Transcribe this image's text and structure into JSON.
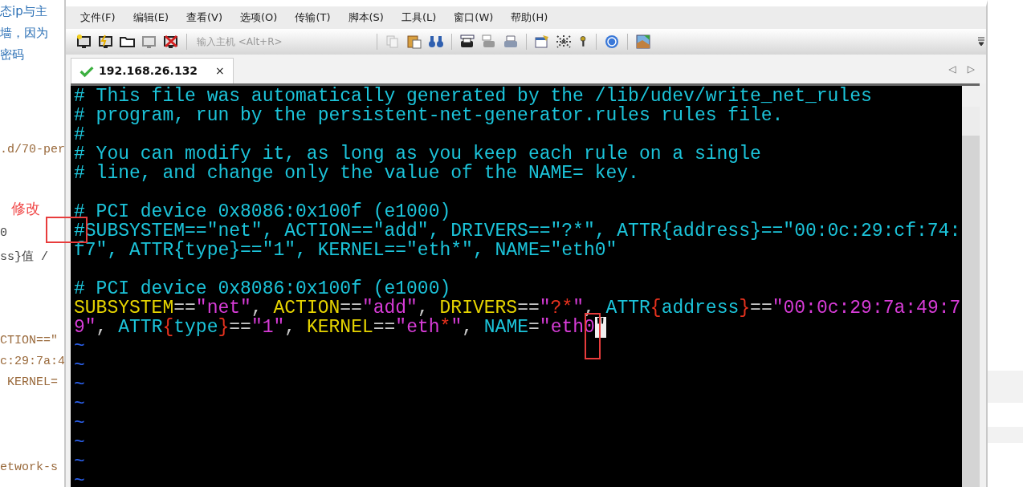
{
  "background_doc": {
    "lines": [
      {
        "text": "态ip与主",
        "kind": "link"
      },
      {
        "text": "墙，因为",
        "kind": "link"
      },
      {
        "text": "密码",
        "kind": "link"
      },
      {
        "text": ".d/70-per",
        "kind": "code"
      },
      {
        "text": "0",
        "kind": "plain"
      },
      {
        "text": "ss}值 /",
        "kind": "plain"
      },
      {
        "text": "CTION==\"",
        "kind": "code"
      },
      {
        "text": "c:29:7a:4",
        "kind": "code"
      },
      {
        "text": " KERNEL=",
        "kind": "code"
      },
      {
        "text": "etwork-s",
        "kind": "code"
      }
    ]
  },
  "menu": [
    "文件(F)",
    "编辑(E)",
    "查看(V)",
    "选项(O)",
    "传输(T)",
    "脚本(S)",
    "工具(L)",
    "窗口(W)",
    "帮助(H)"
  ],
  "toolbar": {
    "host_field": {
      "placeholder": "输入主机 <Alt+R>"
    }
  },
  "tabs": [
    {
      "label": "192.168.26.132",
      "selected": true,
      "connected": true,
      "close": "×"
    }
  ],
  "tab_arrows": [
    "◁",
    "▷"
  ],
  "terminal": {
    "lines": [
      {
        "kind": "text",
        "segments": [
          {
            "text": "# This file was automatically generated by the /lib/udev/write_net_rules",
            "color": "#1cc4da"
          }
        ]
      },
      {
        "kind": "text",
        "segments": [
          {
            "text": "# program, run by the persistent-net-generator.rules rules file.",
            "color": "#1cc4da"
          }
        ]
      },
      {
        "kind": "text",
        "segments": [
          {
            "text": "#",
            "color": "#1cc4da"
          }
        ]
      },
      {
        "kind": "text",
        "segments": [
          {
            "text": "# You can modify it, as long as you keep each rule on a single",
            "color": "#1cc4da"
          }
        ]
      },
      {
        "kind": "text",
        "segments": [
          {
            "text": "# line, and change only the value of the NAME= key.",
            "color": "#1cc4da"
          }
        ]
      },
      {
        "kind": "blank"
      },
      {
        "kind": "text",
        "segments": [
          {
            "text": "# PCI device 0x8086:0x100f (e1000)",
            "color": "#1cc4da"
          }
        ]
      },
      {
        "kind": "text",
        "segments": [
          {
            "text": "#SUBSYSTEM==\"net\", ACTION==\"add\", DRIVERS==\"?*\", ATTR{address}==\"00:0c:29:cf:74:",
            "color": "#1cc4da"
          }
        ]
      },
      {
        "kind": "text",
        "segments": [
          {
            "text": "f7\", ATTR{type}==\"1\", KERNEL==\"eth*\", NAME=\"eth0\"",
            "color": "#1cc4da"
          }
        ]
      },
      {
        "kind": "blank"
      },
      {
        "kind": "text",
        "segments": [
          {
            "text": "# PCI device 0x8086:0x100f (e1000)",
            "color": "#1cc4da"
          }
        ]
      },
      {
        "kind": "text",
        "segments": [
          {
            "text": "SUBSYSTEM",
            "color": "#e6d400"
          },
          {
            "text": "==",
            "color": "#c8c8c8"
          },
          {
            "text": "\"net\"",
            "color": "#d83cd8"
          },
          {
            "text": ", ",
            "color": "#c8c8c8"
          },
          {
            "text": "ACTION",
            "color": "#e6d400"
          },
          {
            "text": "==",
            "color": "#c8c8c8"
          },
          {
            "text": "\"add\"",
            "color": "#d83cd8"
          },
          {
            "text": ", ",
            "color": "#c8c8c8"
          },
          {
            "text": "DRIVERS",
            "color": "#e6d400"
          },
          {
            "text": "==",
            "color": "#c8c8c8"
          },
          {
            "text": "\"",
            "color": "#d83cd8"
          },
          {
            "text": "?*",
            "color": "#e8321e"
          },
          {
            "text": "\"",
            "color": "#d83cd8"
          },
          {
            "text": ", ",
            "color": "#c8c8c8"
          },
          {
            "text": "ATTR",
            "color": "#1cc4da"
          },
          {
            "text": "{",
            "color": "#e8321e"
          },
          {
            "text": "address",
            "color": "#1cc4da"
          },
          {
            "text": "}",
            "color": "#e8321e"
          },
          {
            "text": "==",
            "color": "#c8c8c8"
          },
          {
            "text": "\"00:0c:29:7a:49:7",
            "color": "#d83cd8"
          }
        ]
      },
      {
        "kind": "text",
        "segments": [
          {
            "text": "9\"",
            "color": "#d83cd8"
          },
          {
            "text": ", ",
            "color": "#c8c8c8"
          },
          {
            "text": "ATTR",
            "color": "#1cc4da"
          },
          {
            "text": "{",
            "color": "#e8321e"
          },
          {
            "text": "type",
            "color": "#1cc4da"
          },
          {
            "text": "}",
            "color": "#e8321e"
          },
          {
            "text": "==",
            "color": "#c8c8c8"
          },
          {
            "text": "\"1\"",
            "color": "#d83cd8"
          },
          {
            "text": ", ",
            "color": "#c8c8c8"
          },
          {
            "text": "KERNEL",
            "color": "#e6d400"
          },
          {
            "text": "==",
            "color": "#c8c8c8"
          },
          {
            "text": "\"eth",
            "color": "#d83cd8"
          },
          {
            "text": "*",
            "color": "#e8321e"
          },
          {
            "text": "\"",
            "color": "#d83cd8"
          },
          {
            "text": ", ",
            "color": "#c8c8c8"
          },
          {
            "text": "NAME",
            "color": "#1cc4da"
          },
          {
            "text": "=",
            "color": "#c8c8c8"
          },
          {
            "text": "\"eth0",
            "color": "#d83cd8"
          },
          {
            "text": "\"",
            "color": "#f0f0f0",
            "cursor": true
          }
        ]
      },
      {
        "kind": "tilde",
        "text": "~"
      },
      {
        "kind": "tilde",
        "text": "~"
      },
      {
        "kind": "tilde",
        "text": "~"
      },
      {
        "kind": "tilde",
        "text": "~"
      },
      {
        "kind": "tilde",
        "text": "~"
      },
      {
        "kind": "tilde",
        "text": "~"
      },
      {
        "kind": "tilde",
        "text": "~"
      },
      {
        "kind": "tilde",
        "text": "~"
      }
    ]
  },
  "annotation": {
    "label": "修改"
  }
}
